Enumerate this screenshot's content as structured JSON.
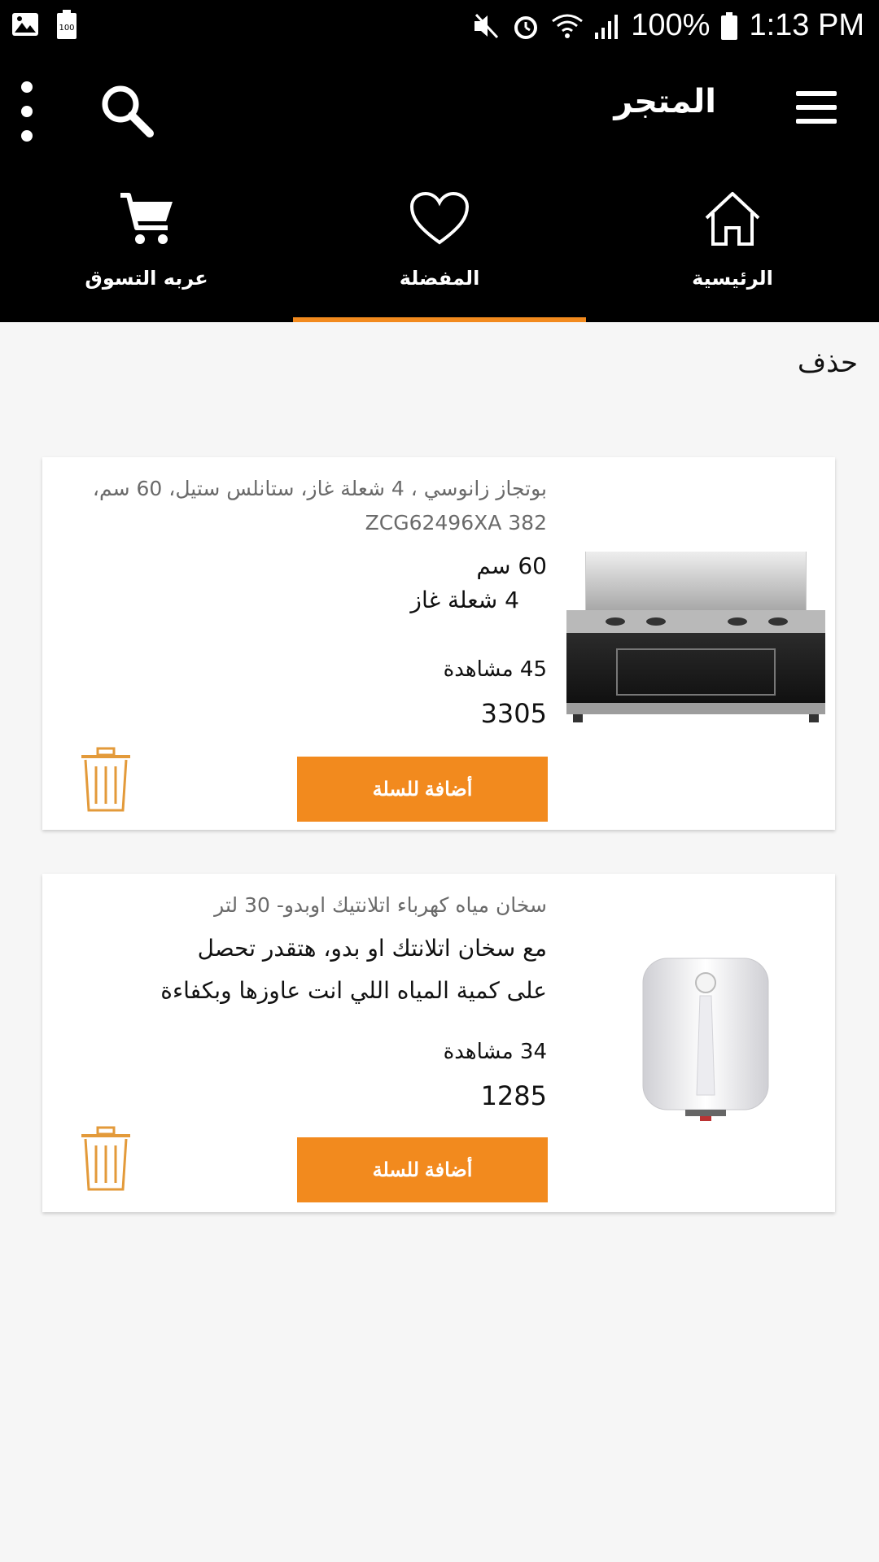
{
  "status_bar": {
    "battery": "100%",
    "time": "1:13 PM",
    "icons": [
      "image-icon",
      "battery-saver-icon",
      "mute-icon",
      "alarm-icon",
      "wifi-icon",
      "signal-icon",
      "battery-icon"
    ]
  },
  "app_bar": {
    "title": "المتجر",
    "icons": [
      "menu-icon",
      "search-icon",
      "more-vert-icon"
    ]
  },
  "tabs": [
    {
      "label": "الرئيسية",
      "icon": "home-icon",
      "active": false
    },
    {
      "label": "المفضلة",
      "icon": "heart-icon",
      "active": true
    },
    {
      "label": "عربه التسوق",
      "icon": "cart-icon",
      "active": false
    }
  ],
  "delete_label": "حذف",
  "products": [
    {
      "name": "بوتجاز زانوسي ، 4 شعلة غاز، ستانلس ستيل، 60 سم، ZCG62496XA 382",
      "desc_line1": "60 سم",
      "desc_line2": "4 شعلة غاز",
      "views": "45 مشاهدة",
      "price": "3305",
      "add_label": "أضافة للسلة"
    },
    {
      "name": "سخان مياه كهرباء اتلانتيك اوبدو- 30 لتر",
      "desc_line1": "مع سخان اتلانتك او بدو، هتقدر تحصل",
      "desc_line2": "على كمية المياه اللي انت عاوزها وبكفاءة",
      "views": "34 مشاهدة",
      "price": "1285",
      "add_label": "أضافة للسلة"
    }
  ],
  "colors": {
    "accent": "#f28a1e",
    "bar": "#000000",
    "background": "#f6f6f6"
  }
}
